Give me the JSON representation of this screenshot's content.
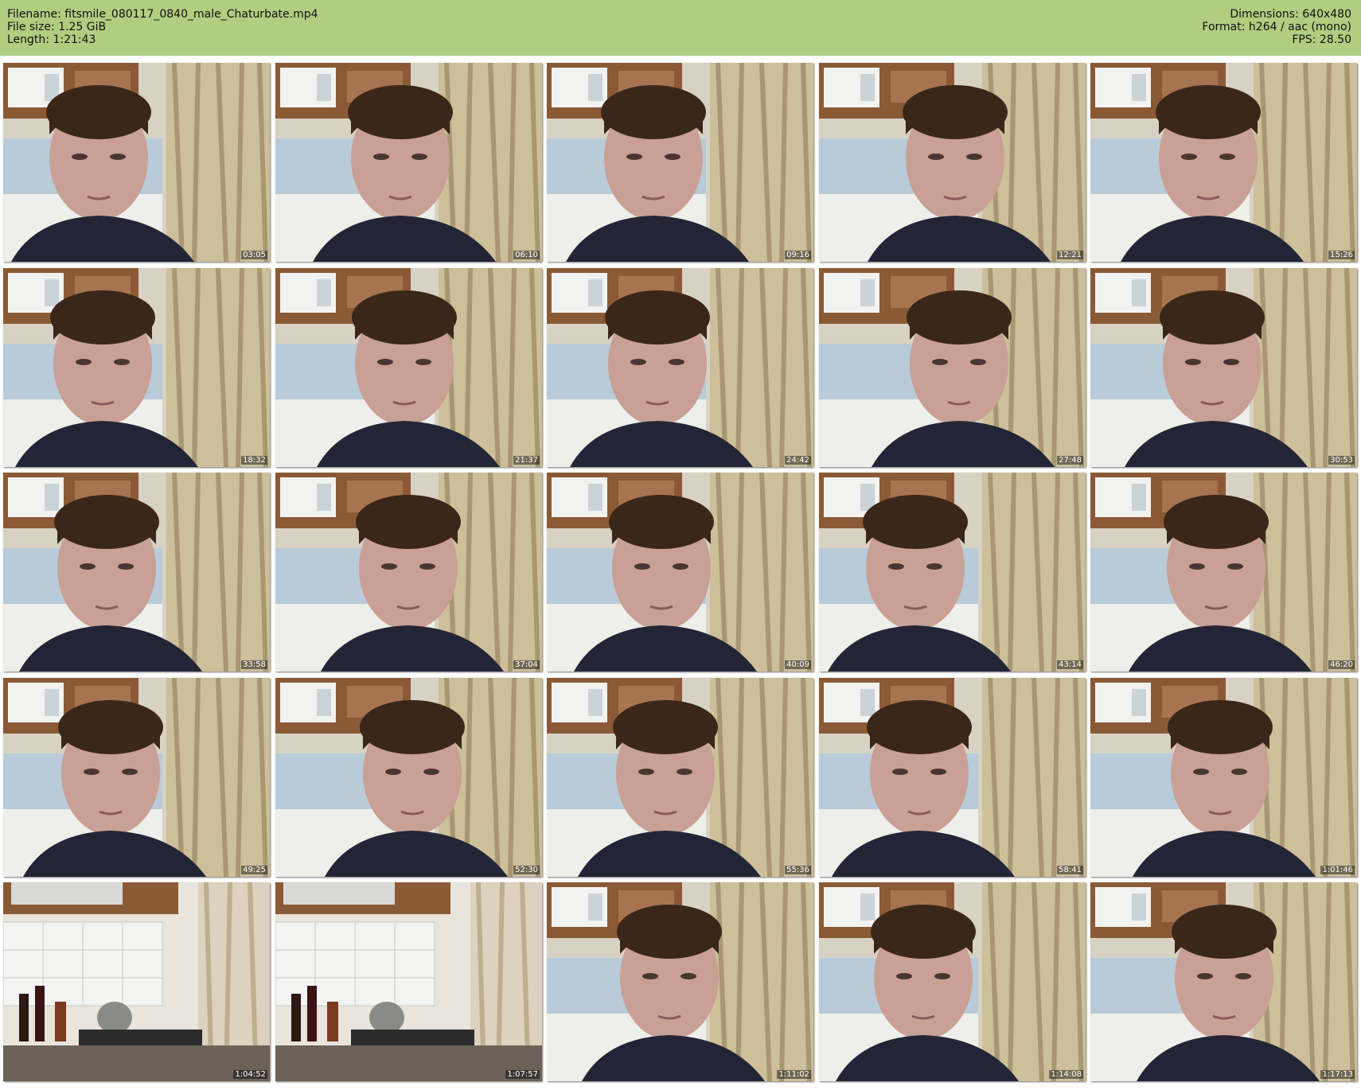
{
  "header": {
    "filename_line": "Filename: fitsmile_080117_0840_male_Chaturbate.mp4",
    "filesize_line": "File size: 1.25 GiB",
    "length_line": "Length: 1:21:43",
    "dimensions_line": "Dimensions: 640x480",
    "format_line": "Format: h264 / aac (mono)",
    "fps_line": "FPS: 28.50"
  },
  "colors": {
    "header_bg": "#b1cd80",
    "timestamp_text": "#ffffff"
  },
  "thumbnails": [
    {
      "time": "03:05",
      "scene": "face"
    },
    {
      "time": "06:10",
      "scene": "face"
    },
    {
      "time": "09:16",
      "scene": "face"
    },
    {
      "time": "12:21",
      "scene": "face"
    },
    {
      "time": "15:26",
      "scene": "face"
    },
    {
      "time": "18:32",
      "scene": "face"
    },
    {
      "time": "21:37",
      "scene": "face"
    },
    {
      "time": "24:42",
      "scene": "face"
    },
    {
      "time": "27:48",
      "scene": "face"
    },
    {
      "time": "30:53",
      "scene": "face"
    },
    {
      "time": "33:58",
      "scene": "face"
    },
    {
      "time": "37:04",
      "scene": "face"
    },
    {
      "time": "40:09",
      "scene": "face"
    },
    {
      "time": "43:14",
      "scene": "face"
    },
    {
      "time": "46:20",
      "scene": "face"
    },
    {
      "time": "49:25",
      "scene": "face"
    },
    {
      "time": "52:30",
      "scene": "face"
    },
    {
      "time": "55:36",
      "scene": "face"
    },
    {
      "time": "58:41",
      "scene": "face"
    },
    {
      "time": "1:01:46",
      "scene": "face"
    },
    {
      "time": "1:04:52",
      "scene": "kitchen"
    },
    {
      "time": "1:07:57",
      "scene": "kitchen"
    },
    {
      "time": "1:11:02",
      "scene": "face"
    },
    {
      "time": "1:14:08",
      "scene": "face"
    },
    {
      "time": "1:17:13",
      "scene": "face"
    }
  ]
}
